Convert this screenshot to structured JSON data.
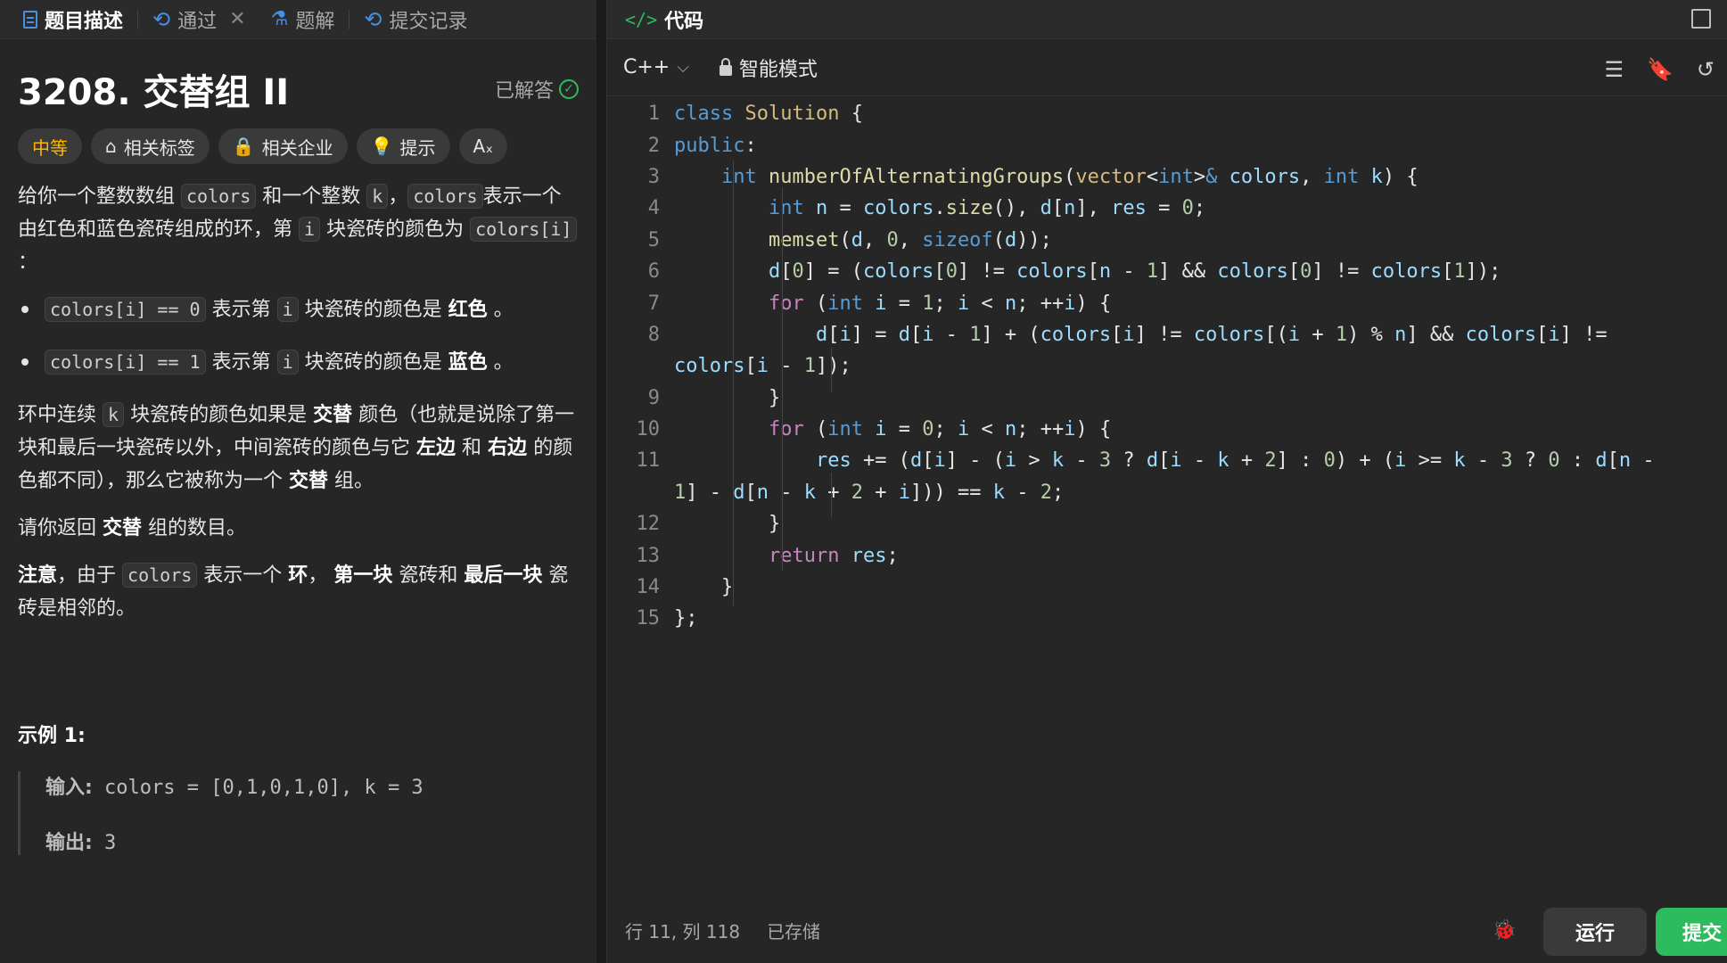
{
  "left_tabs": {
    "description": "题目描述",
    "passed": "通过",
    "close_glyph": "✕",
    "solutions": "题解",
    "submissions": "提交记录"
  },
  "problem": {
    "title": "3208. 交替组 II",
    "status": "已解答",
    "tags": {
      "difficulty": "中等",
      "related_tags": "相关标签",
      "related_companies": "相关企业",
      "hint": "提示",
      "font": "Aₓ"
    },
    "p1": {
      "t1": "给你一个整数数组",
      "c1": "colors",
      "t2": "和一个整数",
      "c2": "k",
      "t3": "，",
      "c3": "colors",
      "t4": "表示一个由红色和蓝色瓷砖组成的环，第",
      "c4": "i",
      "t5": "块瓷砖的颜色为",
      "c5": "colors[i]",
      "t6": "："
    },
    "li1": {
      "c1": "colors[i] == 0",
      "t1": "表示第",
      "c2": "i",
      "t2": "块瓷砖的颜色是",
      "b1": "红色",
      "t3": "。"
    },
    "li2": {
      "c1": "colors[i] == 1",
      "t1": "表示第",
      "c2": "i",
      "t2": "块瓷砖的颜色是",
      "b1": "蓝色",
      "t3": "。"
    },
    "p2": {
      "t1": "环中连续",
      "c1": "k",
      "t2": "块瓷砖的颜色如果是",
      "b1": "交替",
      "t3": "颜色（也就是说除了第一块和最后一块瓷砖以外，中间瓷砖的颜色与它",
      "b2": "左边",
      "t4": "和",
      "b3": "右边",
      "t5": "的颜色都不同），那么它被称为一个",
      "b4": "交替",
      "t6": "组。"
    },
    "p3": {
      "t1": "请你返回",
      "b1": "交替",
      "t2": "组的数目。"
    },
    "p4": {
      "b1": "注意",
      "t1": "，由于",
      "c1": "colors",
      "t2": "表示一个",
      "b2": "环",
      "t3": "，",
      "b3": "第一块",
      "t4": "瓷砖和",
      "b4": "最后一块",
      "t5": "瓷砖是相邻的。"
    },
    "example_title": "示例 1:",
    "example": {
      "input_label": "输入:",
      "input_value": " colors = [0,1,0,1,0], k = 3",
      "output_label": "输出:",
      "output_value": " 3"
    }
  },
  "editor": {
    "header_title": "代码",
    "language": "C++",
    "mode": "智能模式",
    "lines": [
      "1",
      "2",
      "3",
      "4",
      "5",
      "6",
      "7",
      "8",
      "",
      "9",
      "10",
      "11",
      "",
      "12",
      "13",
      "14",
      "15"
    ]
  },
  "status": {
    "position": "行 11, 列 118",
    "saved": "已存储"
  },
  "buttons": {
    "run": "运行",
    "submit": "提交"
  }
}
